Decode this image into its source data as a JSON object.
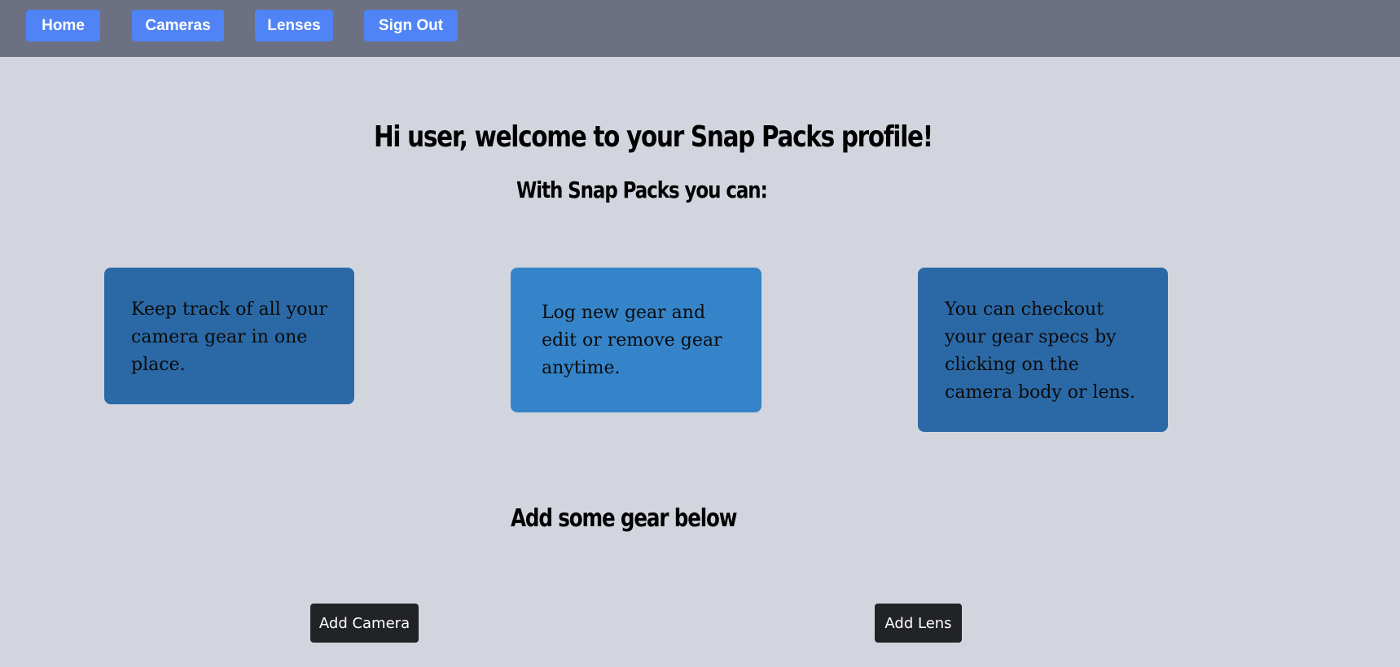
{
  "nav": {
    "home": "Home",
    "cameras": "Cameras",
    "lenses": "Lenses",
    "sign_out": "Sign Out"
  },
  "main": {
    "welcome": "Hi user, welcome to your Snap Packs profile!",
    "subheading": "With Snap Packs you can:",
    "features": [
      "Keep track of all your camera gear in one place.",
      "Log new gear and edit or remove gear anytime.",
      "You can checkout your gear specs by clicking on the camera body or lens."
    ],
    "add_heading": "Add some gear below",
    "add_camera": "Add Camera",
    "add_lens": "Add Lens"
  },
  "colors": {
    "navbar": "#6b7182",
    "nav_button": "#5084f6",
    "page_background": "#d2d5dd",
    "card_dark": "#2b69a6",
    "card_light": "#3584c9",
    "action_button": "#222326"
  }
}
